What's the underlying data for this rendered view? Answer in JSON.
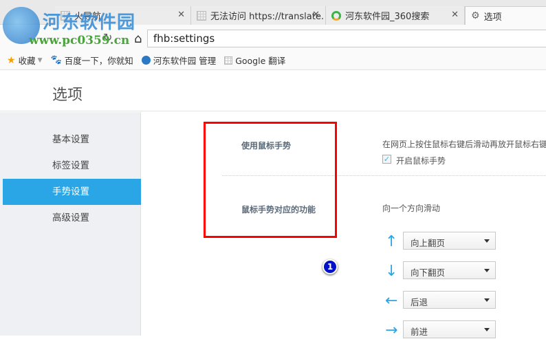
{
  "browser": {
    "tabs": [
      {
        "label": "火导航",
        "icon": "grid-icon"
      },
      {
        "label": "无法访问 https://translate.",
        "icon": "grid-icon"
      },
      {
        "label": "河东软件园_360搜索",
        "icon": "360-search-icon"
      },
      {
        "label": "选项",
        "icon": "gear-icon",
        "active": true
      }
    ],
    "address": "fhb:settings",
    "bookmarks": [
      {
        "label": "收藏",
        "icon": "star-icon"
      },
      {
        "label": "百度一下，你就知",
        "icon": "baidu-icon"
      },
      {
        "label": "河东软件园 管理",
        "icon": "site-icon"
      },
      {
        "label": "Google 翻译",
        "icon": "grid-icon"
      }
    ]
  },
  "watermark": {
    "name": "河东软件园",
    "url": "www.pc0359.cn"
  },
  "page": {
    "title": "选项",
    "sidebar": [
      {
        "label": "基本设置"
      },
      {
        "label": "标签设置"
      },
      {
        "label": "手势设置",
        "active": true
      },
      {
        "label": "高级设置"
      }
    ],
    "gesture": {
      "use_label": "使用鼠标手势",
      "use_desc": "在网页上按住鼠标右键后滑动再放开鼠标右键",
      "enable_label": "开启鼠标手势",
      "enabled": true,
      "func_label": "鼠标手势对应的功能",
      "func_desc": "向一个方向滑动",
      "mappings": [
        {
          "direction": "up",
          "arrow": "↑",
          "action": "向上翻页"
        },
        {
          "direction": "down",
          "arrow": "↓",
          "action": "向下翻页"
        },
        {
          "direction": "left",
          "arrow": "←",
          "action": "后退"
        },
        {
          "direction": "right",
          "arrow": "→",
          "action": "前进"
        }
      ]
    },
    "annotation": "1"
  },
  "colors": {
    "accent": "#2aa6e6",
    "highlight": "#ff0000",
    "badge": "#0010c8"
  }
}
